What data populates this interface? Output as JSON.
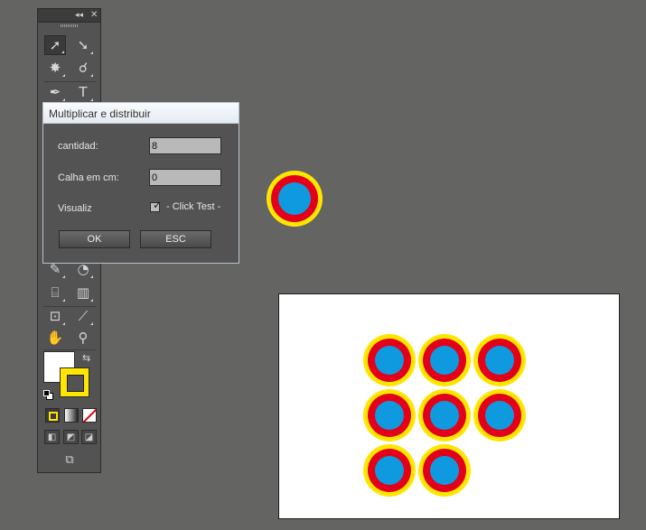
{
  "toolbar": {
    "collapse_icon": "double-chevron-left-icon",
    "close_icon": "close-icon",
    "tools": [
      {
        "name": "selection-tool",
        "icon": "arrow-cursor-icon",
        "glyph": "➚"
      },
      {
        "name": "direct-selection-tool",
        "icon": "hollow-arrow-icon",
        "glyph": "➘"
      },
      {
        "name": "magic-wand-tool",
        "icon": "magic-wand-icon",
        "glyph": "✸"
      },
      {
        "name": "lasso-tool",
        "icon": "lasso-icon",
        "glyph": "☌"
      },
      {
        "name": "pen-tool",
        "icon": "pen-nib-icon",
        "glyph": "✒"
      },
      {
        "name": "type-tool",
        "icon": "type-icon",
        "glyph": "T"
      },
      {
        "name": "eyedropper-tool",
        "icon": "eyedropper-icon",
        "glyph": "✎"
      },
      {
        "name": "blend-tool",
        "icon": "blend-icon",
        "glyph": "◔"
      },
      {
        "name": "symbol-sprayer-tool",
        "icon": "symbol-sprayer-icon",
        "glyph": "⌸"
      },
      {
        "name": "graph-tool",
        "icon": "bar-graph-icon",
        "glyph": "▥"
      },
      {
        "name": "artboard-tool",
        "icon": "artboard-icon",
        "glyph": "⊡"
      },
      {
        "name": "slice-tool",
        "icon": "slice-knife-icon",
        "glyph": "⟋"
      },
      {
        "name": "hand-tool",
        "icon": "hand-icon",
        "glyph": "✋"
      },
      {
        "name": "zoom-tool",
        "icon": "zoom-magnifier-icon",
        "glyph": "⚲"
      }
    ],
    "fill_color": "#ffffff",
    "stroke_color": "#ffe600"
  },
  "dialog": {
    "title": "Multiplicar e distribuir",
    "quantity_label": "cantidad:",
    "quantity_value": "8",
    "gutter_label": "Calha em cm:",
    "gutter_value": "0",
    "preview_label": "Visualiz",
    "checkbox_label": "- Click Test -",
    "checkbox_checked": true,
    "ok_label": "OK",
    "esc_label": "ESC"
  },
  "artwork": {
    "colors": {
      "outer": "#ffe600",
      "middle": "#e3001b",
      "inner": "#0f99de"
    },
    "copies_on_artboard": 8,
    "columns": 3
  }
}
